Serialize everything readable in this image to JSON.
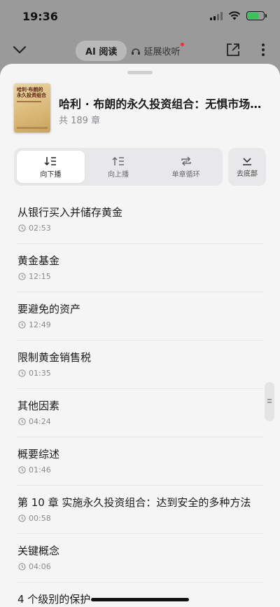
{
  "status": {
    "time": "19:36"
  },
  "nav": {
    "ai_read_label": "AI 阅读",
    "extended_label": "延展收听"
  },
  "book": {
    "cover_title": "哈利·布朗的永久投资组合",
    "title": "哈利 · 布朗的永久投资组合：无惧市场…",
    "chapter_count": "共 189 章"
  },
  "controls": {
    "play_down": "向下播",
    "play_up": "向上播",
    "loop_chapter": "单章循环",
    "go_bottom": "去底部"
  },
  "chapters": [
    {
      "title": "从银行买入并储存黄金",
      "duration": "02:53"
    },
    {
      "title": "黄金基金",
      "duration": "12:15"
    },
    {
      "title": "要避免的资产",
      "duration": "12:49"
    },
    {
      "title": "限制黄金销售税",
      "duration": "01:35"
    },
    {
      "title": "其他因素",
      "duration": "04:24"
    },
    {
      "title": "概要综述",
      "duration": "01:46"
    },
    {
      "title": "第 10 章  实施永久投资组合：达到安全的多种方法",
      "duration": "00:58"
    },
    {
      "title": "关键概念",
      "duration": "04:06"
    },
    {
      "title": "4 个级别的保护",
      "duration": ""
    }
  ],
  "colors": {
    "sheet_bg": "#f5f5f6",
    "battery_green": "#35c759",
    "badge_red": "#e33333"
  }
}
